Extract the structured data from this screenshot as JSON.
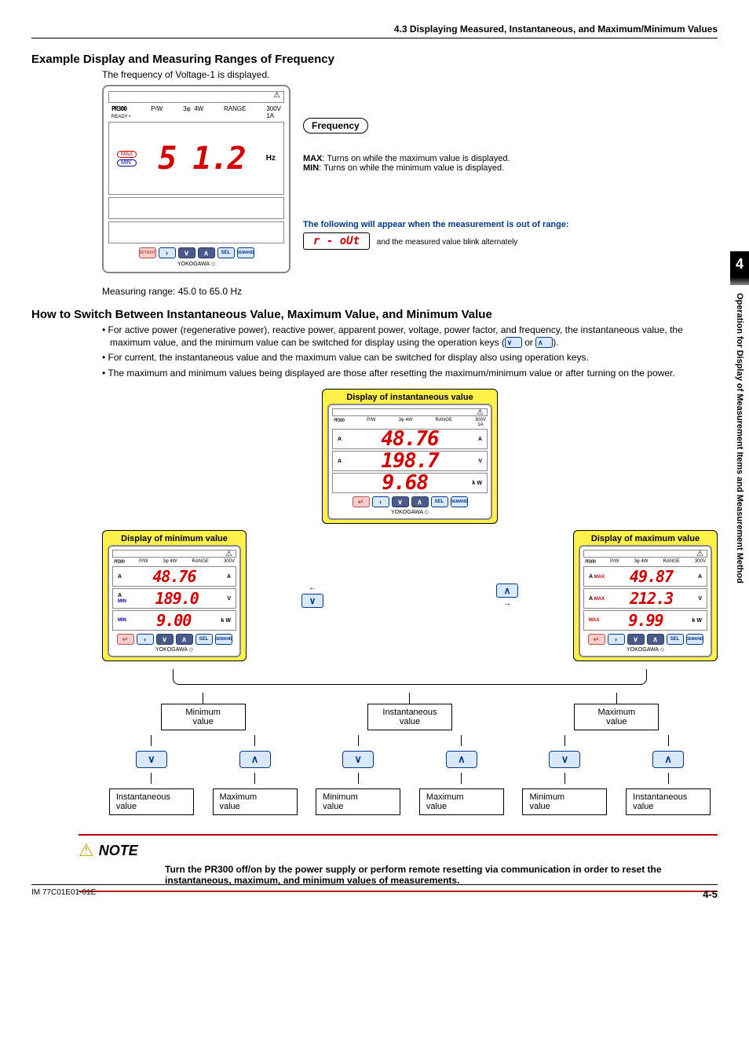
{
  "header": {
    "section": "4.3    Displaying Measured, Instantaneous, and Maximum/Minimum Values"
  },
  "h1": "Example Display and Measuring Ranges of Frequency",
  "sub1": "The frequency of Voltage-1 is displayed.",
  "device1": {
    "model": "PR300",
    "ready": "READY •",
    "pw": "P/W",
    "three": "3φ",
    "four": "4W",
    "range": "RANGE",
    "v": "300V",
    "a": "1A",
    "max": "MAX",
    "min": "MIN",
    "value": "5 1.2",
    "unit": "Hz",
    "brand": "YOKOGAWA ◇",
    "btn_set": "SET/ENT",
    "btn_sel": "SEL",
    "btn_demand": "DEMAND"
  },
  "freq_label": "Frequency",
  "mm": {
    "max": "MAX",
    "max_txt": ": Turns on while the maximum value is displayed.",
    "min": "MIN",
    "min_txt": ": Turns on while the minimum value is displayed."
  },
  "out": {
    "blue": "The following will appear when the measurement is out of range:",
    "rout": "r - oUt",
    "after": "and the measured value blink alternately"
  },
  "range_note": "Measuring range: 45.0 to 65.0 Hz",
  "h2": "How to Switch Between Instantaneous Value, Maximum Value, and Minimum Value",
  "bullets": [
    "For active power (regenerative power), reactive power, apparent power, voltage, power factor, and frequency, the instantaneous value, the maximum value, and the minimum value can be switched for display using the operation keys (",
    "For current, the instantaneous value and the maximum value can be switched for display also using operation keys.",
    "The maximum and minimum values being displayed are those after resetting the maximum/minimum value or after turning on the power."
  ],
  "bullet1_mid": " or ",
  "bullet1_end": ").",
  "diagram": {
    "inst_title": "Display of instantaneous value",
    "min_title": "Display of minimum value",
    "max_title": "Display of maximum value",
    "inst": {
      "r1": "48.76",
      "r1u": "A",
      "r2": "198.7",
      "r2u": "V",
      "r3": "9.68",
      "r3u": "k  W"
    },
    "min": {
      "r1": "48.76",
      "r1u": "A",
      "r2": "189.0",
      "r2u": "V",
      "r3": "9.00",
      "r3u": "k  W"
    },
    "max": {
      "r1": "49.87",
      "r1u": "A",
      "r2": "212.3",
      "r2u": "V",
      "r3": "9.99",
      "r3u": "k  W"
    },
    "tagA": "A",
    "tagMax": "MAX",
    "tagMin": "MIN"
  },
  "states": {
    "min": "Minimum\nvalue",
    "inst": "Instantaneous\nvalue",
    "max": "Maximum\nvalue"
  },
  "note": {
    "title": "NOTE",
    "body": "Turn the PR300 off/on by the power supply or perform remote resetting via communication in order to reset the instantaneous, maximum, and minimum values of measurements."
  },
  "footer": {
    "doc": "IM 77C01E01-01E",
    "page": "4-5"
  },
  "sidetab": {
    "num": "4",
    "text": "Operation for Display of Measurement Items and Measurement Method"
  }
}
